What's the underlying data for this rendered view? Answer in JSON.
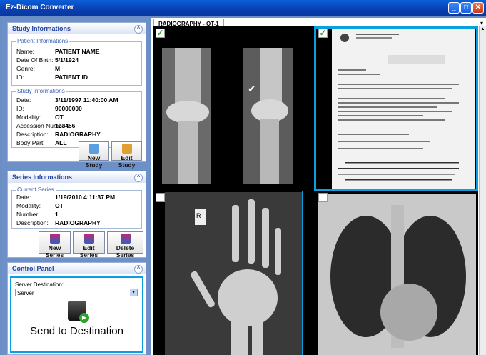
{
  "window": {
    "title": "Ez-Dicom Converter"
  },
  "study_panel": {
    "title": "Study Informations",
    "patient_group": "Patient Informations",
    "patient_rows": [
      {
        "label": "Name:",
        "value": "PATIENT NAME"
      },
      {
        "label": "Date Of Birth:",
        "value": "5/1/1924"
      },
      {
        "label": "Genre:",
        "value": "M"
      },
      {
        "label": "ID:",
        "value": "PATIENT ID"
      }
    ],
    "study_group": "Study Informations",
    "study_rows": [
      {
        "label": "Date:",
        "value": "3/11/1997 11:40:00 AM"
      },
      {
        "label": "ID:",
        "value": "90000000"
      },
      {
        "label": "Modality:",
        "value": "OT"
      },
      {
        "label": "Accession Number:",
        "value": "123456"
      },
      {
        "label": "Description:",
        "value": "RADIOGRAPHY"
      },
      {
        "label": "Body Part:",
        "value": "ALL"
      }
    ],
    "buttons": {
      "new_study": "New Study",
      "edit_study": "Edit Study"
    }
  },
  "series_panel": {
    "title": "Series Informations",
    "group": "Current Series",
    "rows": [
      {
        "label": "Date:",
        "value": "1/19/2010 4:11:37 PM"
      },
      {
        "label": "Modality:",
        "value": "OT"
      },
      {
        "label": "Number:",
        "value": "1"
      },
      {
        "label": "Description:",
        "value": "RADIOGRAPHY"
      }
    ],
    "buttons": {
      "new_series": "New Series",
      "edit_series": "Edit Series",
      "delete_series": "Delete Series"
    }
  },
  "control_panel": {
    "title": "Control Panel",
    "server_label": "Server Destination:",
    "server_value": "Server",
    "send_label": "Send to Destination"
  },
  "viewer": {
    "tab_label": "RADIOGRAPHY - OT-1",
    "checkmark": "✓",
    "cells": [
      {
        "name": "knee-xray",
        "checked": true
      },
      {
        "name": "report-document",
        "checked": true
      },
      {
        "name": "hand-xray",
        "checked": false
      },
      {
        "name": "chest-xray",
        "checked": false
      }
    ]
  },
  "colors": {
    "accent": "#0aa0e0",
    "titlebar": "#0a4fc8",
    "panel_title": "#21419c"
  }
}
